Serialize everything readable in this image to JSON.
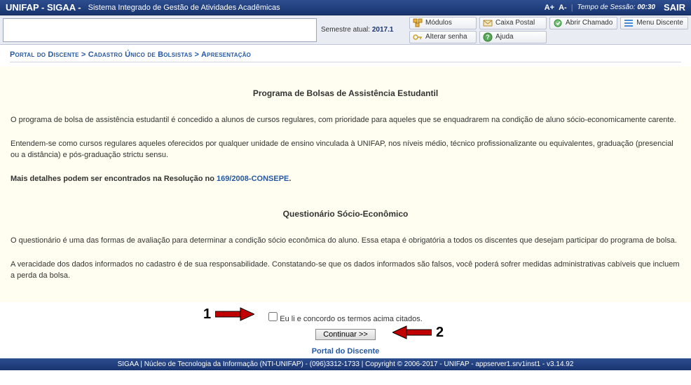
{
  "topbar": {
    "system_name": "UNIFAP - SIGAA -",
    "system_desc": "Sistema Integrado de Gestão de Atividades Acadêmicas",
    "font_inc": "A+",
    "font_dec": "A-",
    "session_label": "Tempo de Sessão:",
    "session_time": "00:30",
    "sair": "SAIR"
  },
  "toolbar": {
    "semestre_label": "Semestre atual:",
    "semestre_value": "2017.1",
    "buttons": {
      "modulos": "Módulos",
      "caixa_postal": "Caixa Postal",
      "abrir_chamado": "Abrir Chamado",
      "menu_discente": "Menu Discente",
      "alterar_senha": "Alterar senha",
      "ajuda": "Ajuda"
    }
  },
  "breadcrumb": {
    "part1": "Portal do Discente",
    "sep": ">",
    "part2": "Cadastro Único de Bolsistas",
    "part3": "Apresentação"
  },
  "section1_title": "Programa de Bolsas de Assistência Estudantil",
  "p1": "O programa de bolsa de assistência estudantil é concedido a alunos de cursos regulares, com prioridade para aqueles que se enquadrarem na condição de aluno sócio-economicamente carente.",
  "p2": "Entendem-se como cursos regulares aqueles oferecidos por qualquer unidade de ensino vinculada à UNIFAP, nos níveis médio, técnico profissionalizante ou equivalentes, graduação (presencial ou a distância) e pós-graduação strictu sensu.",
  "p3_a": "Mais detalhes podem ser encontrados na Resolução no ",
  "p3_link": "169/2008-CONSEPE",
  "p3_b": ".",
  "section2_title": "Questionário Sócio-Econômico",
  "p4": "O questionário é uma das formas de avaliação para determinar a condição sócio econômica do aluno. Essa etapa é obrigatória a todos os discentes que desejam participar do programa de bolsa.",
  "p5": "A veracidade dos dados informados no cadastro é de sua responsabilidade. Constatando-se que os dados informados são falsos, você poderá sofrer medidas administrativas cabíveis que incluem a perda da bolsa.",
  "agree_label": "Eu li e concordo os termos acima citados.",
  "continuar": "Continuar >>",
  "ann1": "1",
  "ann2": "2",
  "portal_link": "Portal do Discente",
  "footer": "SIGAA | Núcleo de Tecnologia da Informação (NTI-UNIFAP) - (096)3312-1733 | Copyright © 2006-2017 - UNIFAP - appserver1.srv1inst1 - v3.14.92"
}
